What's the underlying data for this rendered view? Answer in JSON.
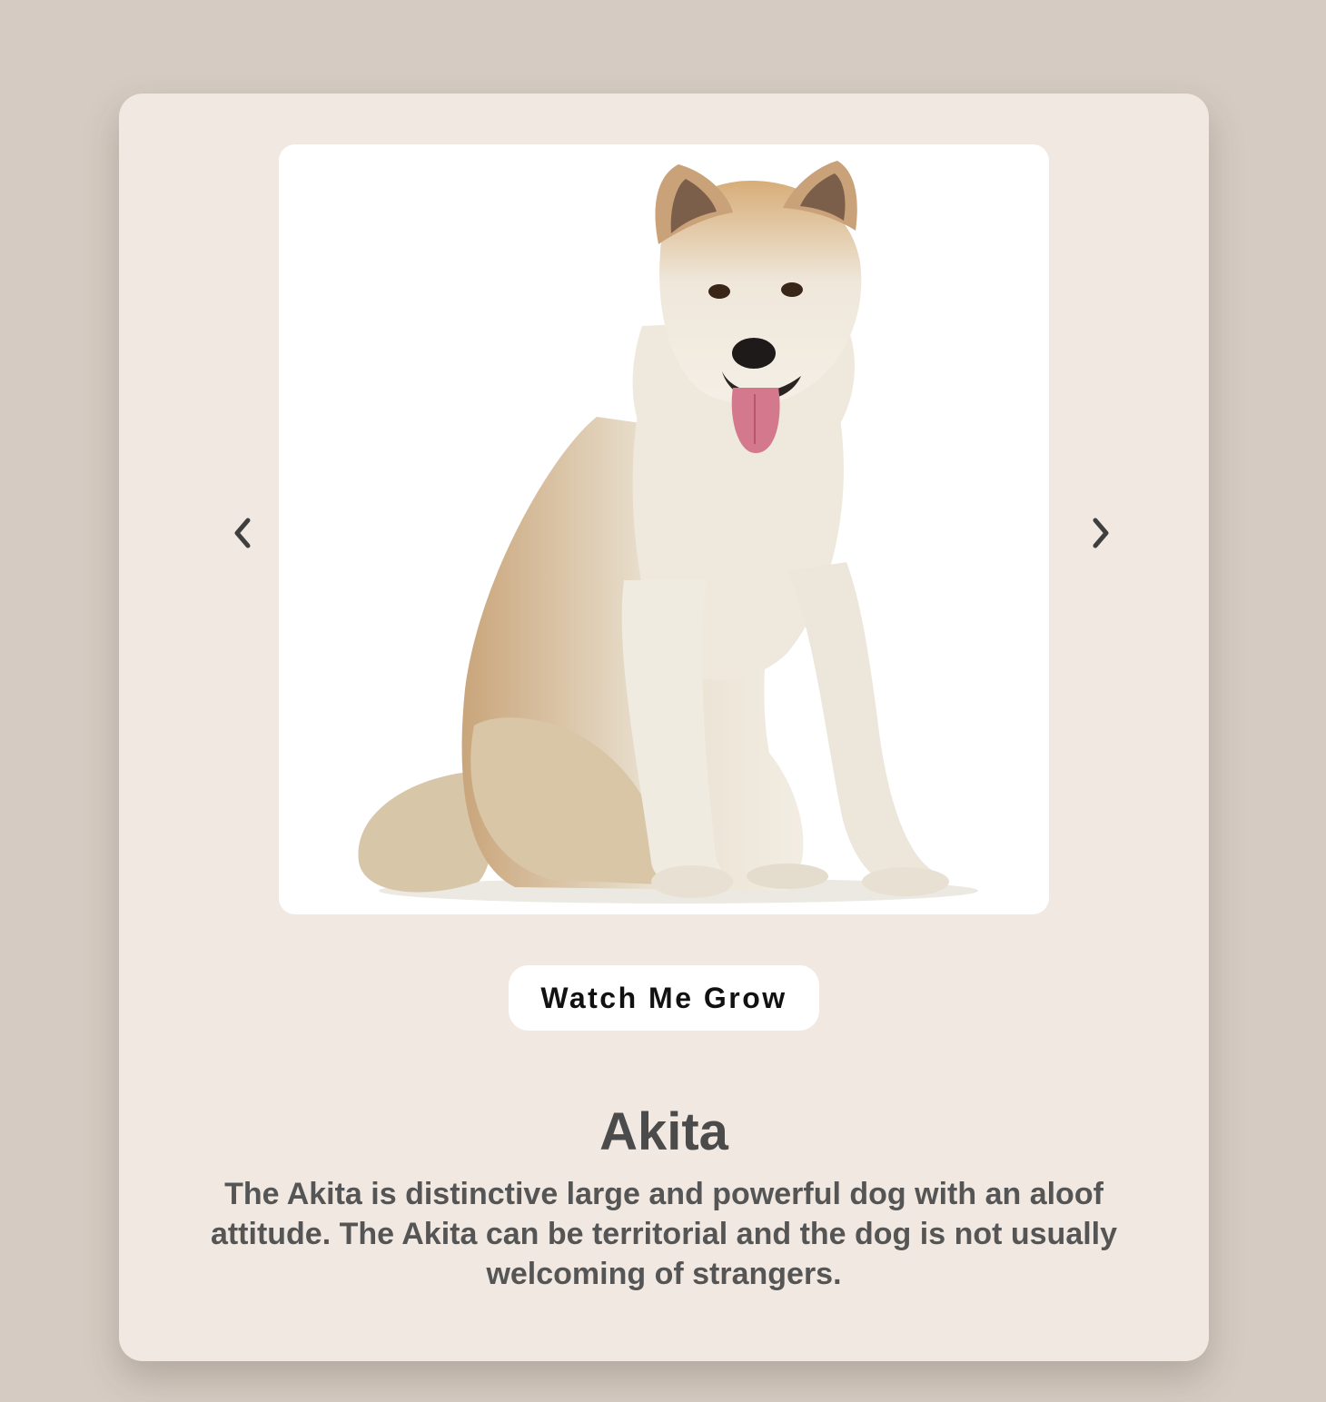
{
  "colors": {
    "page_background": "#d5cbc2",
    "card_background": "#f1e9e1",
    "text_primary": "#4b4b4b",
    "arrow": "#3f3f3f"
  },
  "carousel": {
    "image_subject": "akita-dog-photo",
    "prev_icon": "chevron-left-icon",
    "next_icon": "chevron-right-icon"
  },
  "actions": {
    "watch_label": "Watch Me Grow"
  },
  "breed": {
    "name": "Akita",
    "description": "The Akita is distinctive large and powerful dog with an aloof attitude. The Akita can be territorial and the dog is not usually welcoming of strangers."
  }
}
